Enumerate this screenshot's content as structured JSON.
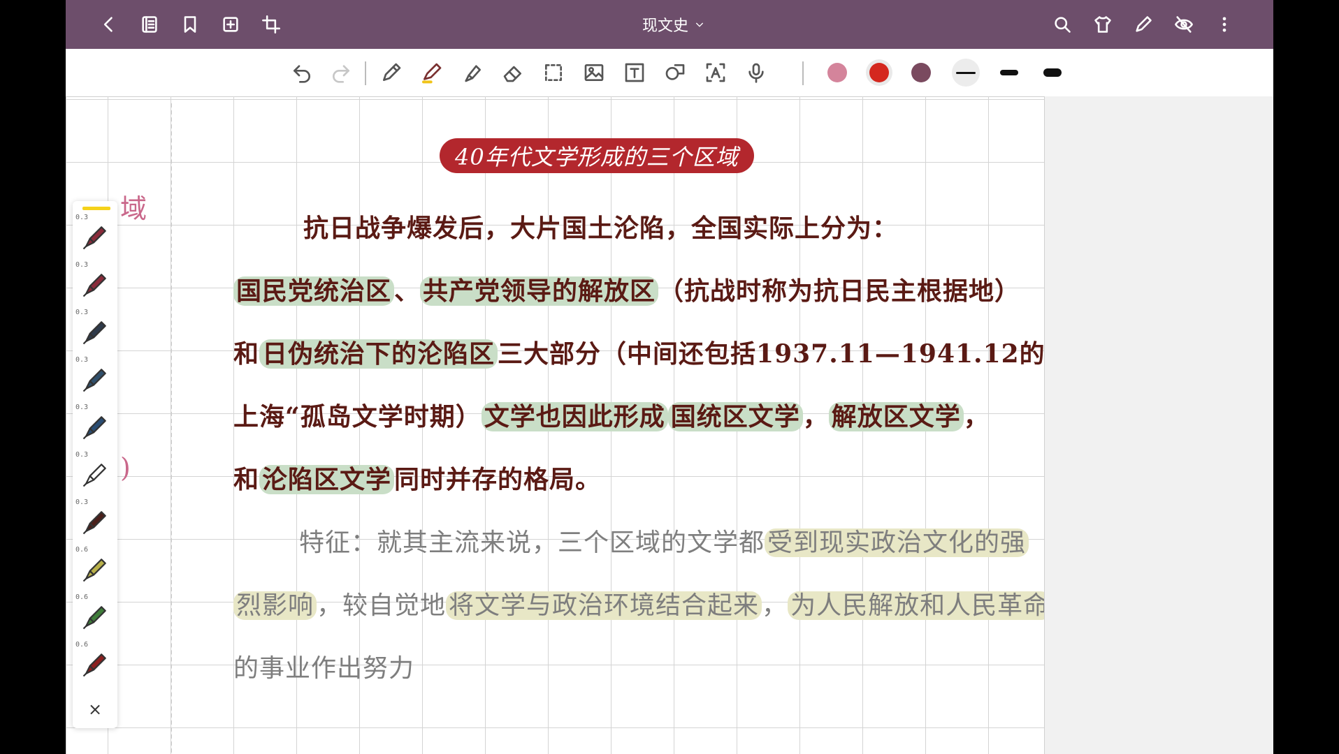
{
  "topbar": {
    "title": "现文史",
    "icons": [
      "back-icon",
      "pages-icon",
      "bookmark-icon",
      "add-page-icon",
      "crop-icon",
      "search-icon",
      "theme-shirt-icon",
      "pen-mode-icon",
      "hide-icon",
      "more-icon"
    ]
  },
  "toolbar": {
    "tools": [
      "undo-icon",
      "redo-icon",
      "pencil-icon",
      "pen-icon",
      "highlighter-icon",
      "eraser-icon",
      "lasso-select-icon",
      "image-icon",
      "text-box-icon",
      "shape-icon",
      "ocr-text-icon",
      "microphone-icon"
    ],
    "colors": [
      "#d4849b",
      "#d4281f",
      "#7a4a5f"
    ],
    "selected_color": "#d4281f",
    "stroke_widths": [
      "thin",
      "medium",
      "thick"
    ]
  },
  "pen_palette": {
    "pens": [
      {
        "size": "0.3",
        "color": "#8a2b3b"
      },
      {
        "size": "0.3",
        "color": "#8a2b3b"
      },
      {
        "size": "0.3",
        "color": "#2e3a4a"
      },
      {
        "size": "0.3",
        "color": "#2f4f6b"
      },
      {
        "size": "0.3",
        "color": "#2a4d73"
      },
      {
        "size": "0.3",
        "color": "#ffffff"
      },
      {
        "size": "0.3",
        "color": "#4a1f1a"
      },
      {
        "size": "0.6",
        "color": "#b8b04a"
      },
      {
        "size": "0.6",
        "color": "#3f7d3a"
      },
      {
        "size": "0.6",
        "color": "#8c1f1f"
      }
    ],
    "close_label": "×"
  },
  "margin_fragments": [
    "域",
    ")"
  ],
  "note": {
    "title": "40年代文学形成的三个区域",
    "para1": {
      "line1": "抗日战争爆发后，大片国土沦陷，全国实际上分为：",
      "line2_hl1": "国民党统治区",
      "line2_mid": "、",
      "line2_hl2": "共产党领导的解放区",
      "line2_rest": "（抗战时称为抗日民主根据地）",
      "line3_a": "和",
      "line3_hl": "日伪统治下的沦陷区",
      "line3_rest": "三大部分（中间还包括1937.11—1941.12的",
      "line4_a": "上海“孤岛文学时期）",
      "line4_hl1": "文学也因此形成",
      "line4_hl2": "国统区文学",
      "line4_mid": "，",
      "line4_hl3": "解放区文学",
      "line4_end": "，",
      "line5_a": "和",
      "line5_hl": "沦陷区文学",
      "line5_rest": "同时并存的格局。"
    },
    "para2": {
      "line1_a": "特征：就其主流来说，三个区域的文学都",
      "line1_hl": "受到现实政治文化的强",
      "line2_hl1": "烈影响",
      "line2_mid": "，较自觉地",
      "line2_hl2": "将文学与政治环境结合起来",
      "line2_mid2": "，",
      "line2_hl3": "为人民解放和人民革命",
      "line3": "的事业作出努力"
    }
  }
}
